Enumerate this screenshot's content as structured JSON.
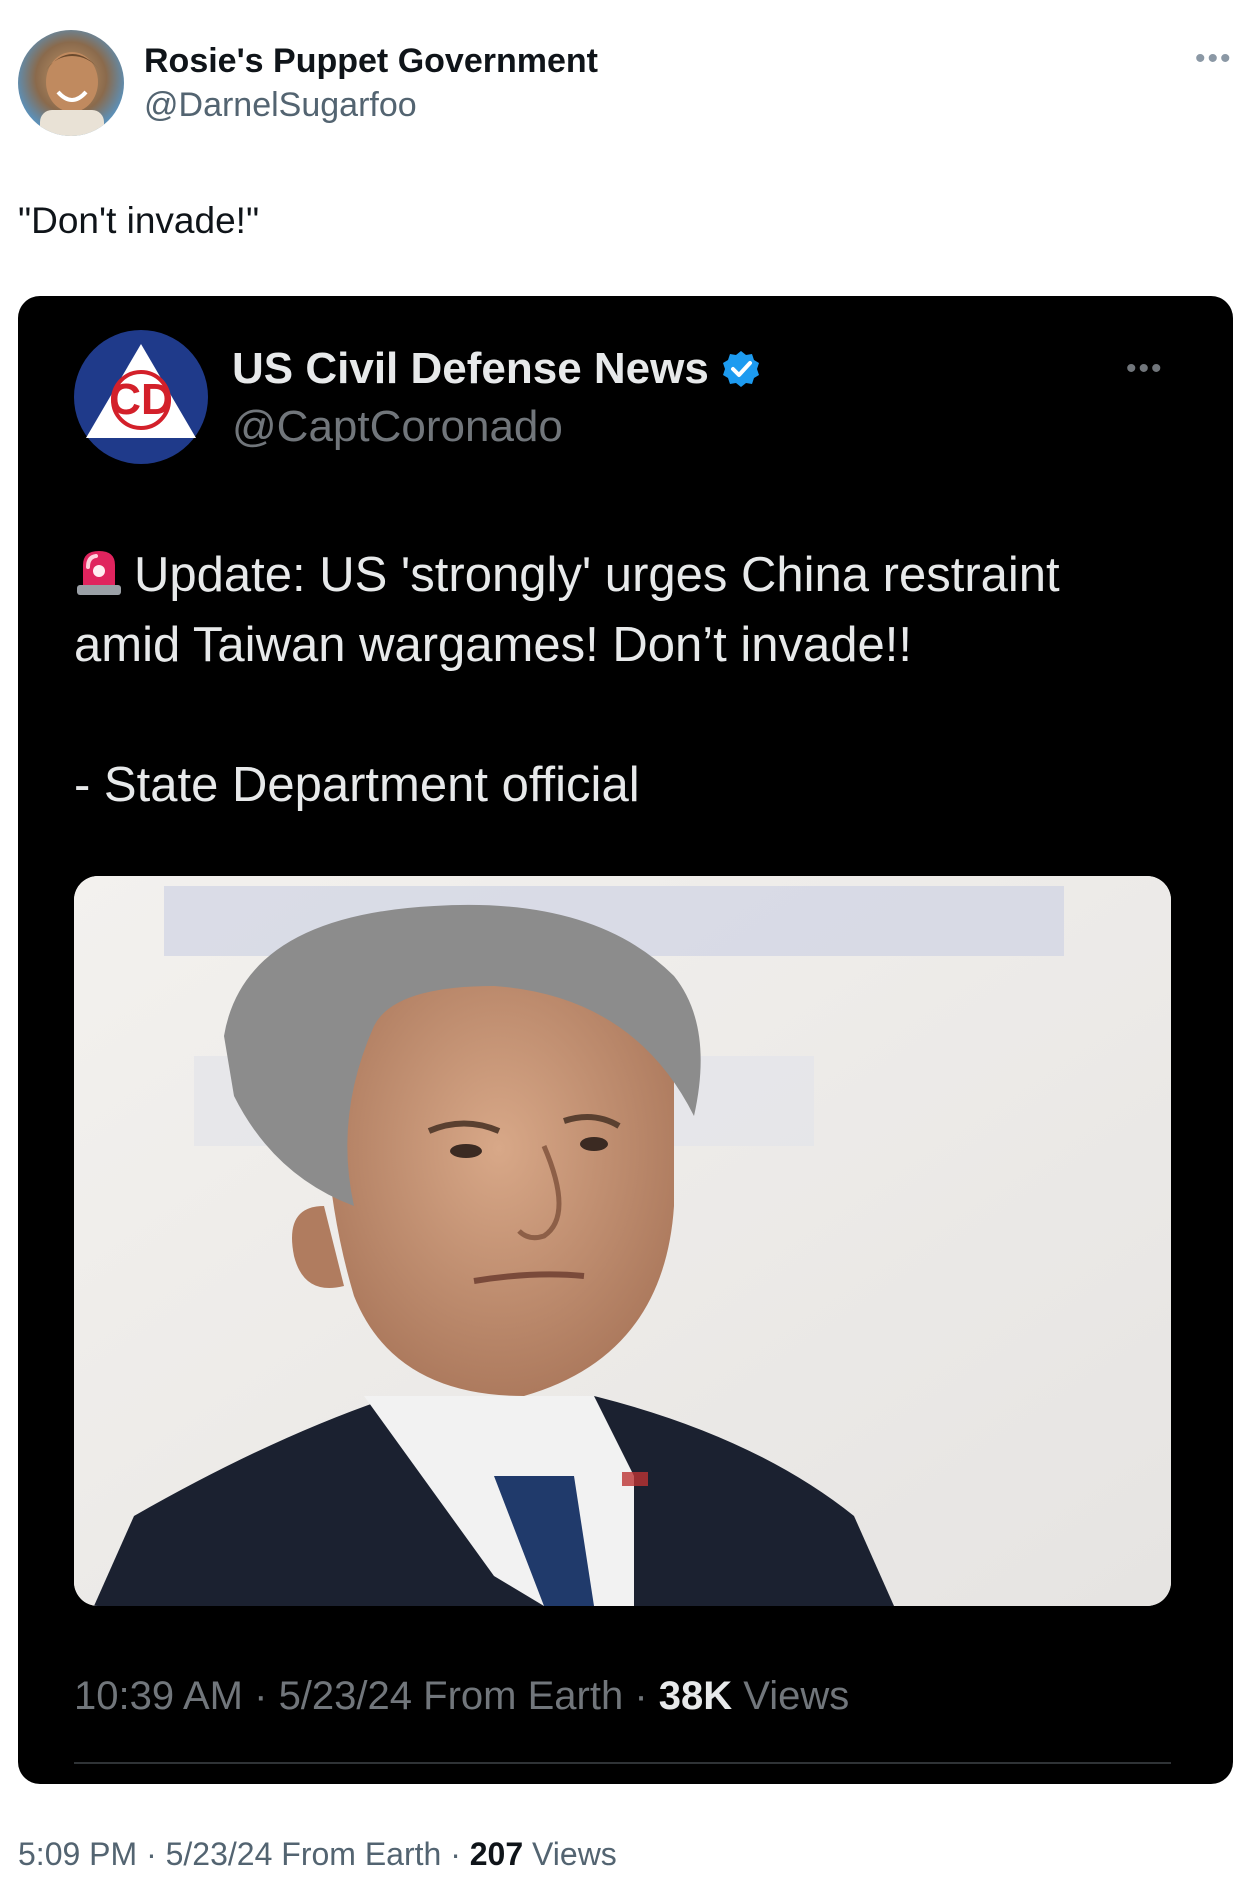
{
  "tweet": {
    "author_name": "Rosie's Puppet Government",
    "author_handle": "@DarnelSugarfoo",
    "text": "\"Don't invade!\"",
    "time": "5:09 PM",
    "date": "5/23/24",
    "source": "From Earth",
    "views_count": "207",
    "views_label": "Views",
    "more_icon": "more-horizontal-icon"
  },
  "quote": {
    "author_name": "US Civil Defense News",
    "author_handle": "@CaptCoronado",
    "verified_icon": "verified-badge-icon",
    "logo_icon": "civil-defense-logo",
    "siren_icon": "police-light-emoji",
    "line1": "Update: US 'strongly' urges China restraint",
    "line2": "amid Taiwan wargames! Don’t invade!!",
    "line3": "- State Department official",
    "time": "10:39 AM",
    "date": "5/23/24",
    "source": "From Earth",
    "views_count": "38K",
    "views_label": "Views",
    "more_icon": "more-horizontal-icon"
  },
  "colors": {
    "quote_bg": "#000000",
    "verified_blue": "#1d9bf0",
    "secondary_text": "#536471",
    "dark_secondary_text": "#71767b"
  }
}
